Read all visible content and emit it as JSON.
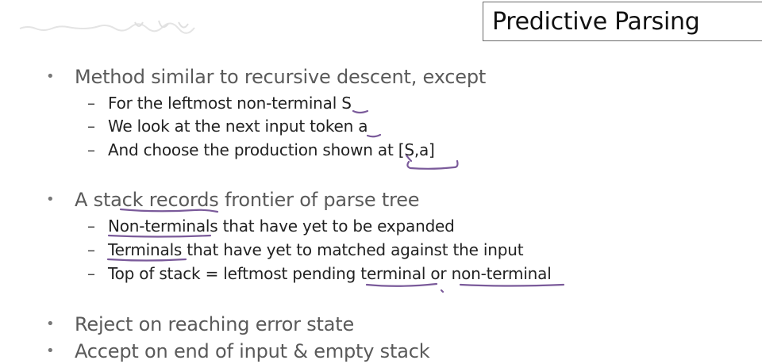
{
  "slide": {
    "title": "Predictive Parsing",
    "bullets": [
      {
        "text": "Method similar to recursive descent, except",
        "subs": [
          "For the leftmost non-terminal S",
          "We look at the next input token a",
          "And choose the production shown at [S,a]"
        ]
      },
      {
        "text": "A stack records frontier of parse tree",
        "subs": [
          "Non-terminals that have yet to be expanded",
          "Terminals that have yet to matched against the input",
          "Top of stack = leftmost pending terminal or non-terminal"
        ]
      },
      {
        "text": "Reject on reaching error state",
        "subs": []
      },
      {
        "text": "Accept on end of input & empty stack",
        "subs": []
      }
    ]
  },
  "colors": {
    "annotation_ink": "#7a5a9a",
    "bullet_text": "#5a5a5a",
    "sub_text": "#222222"
  },
  "icons": {
    "bullet": "•",
    "dash": "–"
  }
}
